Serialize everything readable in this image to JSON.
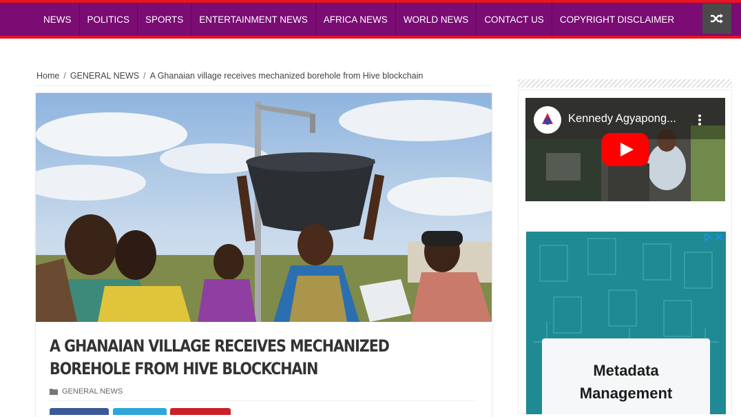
{
  "nav": {
    "items": [
      {
        "label": "NEWS"
      },
      {
        "label": "POLITICS"
      },
      {
        "label": "SPORTS"
      },
      {
        "label": "ENTERTAINMENT NEWS"
      },
      {
        "label": "AFRICA NEWS"
      },
      {
        "label": "WORLD NEWS"
      },
      {
        "label": "CONTACT US"
      },
      {
        "label": "COPYRIGHT DISCLAIMER"
      }
    ],
    "shuffle_icon": "shuffle-icon"
  },
  "breadcrumb": {
    "home": "Home",
    "separator": "/",
    "category": "GENERAL NEWS",
    "current": "A Ghanaian village receives mechanized borehole from Hive blockchain"
  },
  "article": {
    "title": "A Ghanaian village receives mechanized borehole from Hive blockchain",
    "category": "GENERAL NEWS",
    "category_icon": "folder-icon"
  },
  "sidebar": {
    "video": {
      "title": "Kennedy Agyapong...",
      "play_icon": "youtube-play-icon",
      "menu_icon": "more-vertical-icon"
    },
    "ad": {
      "line1": "Metadata",
      "line2": "Management",
      "adchoices_icon": "adchoices-icon",
      "close_icon": "close-icon"
    }
  },
  "colors": {
    "nav_bg": "#7a0c73",
    "nav_border": "#e8141e",
    "shuffle_bg": "#4a4a4a",
    "ad_bg": "#1f8a93",
    "youtube_red": "#ff0000"
  }
}
